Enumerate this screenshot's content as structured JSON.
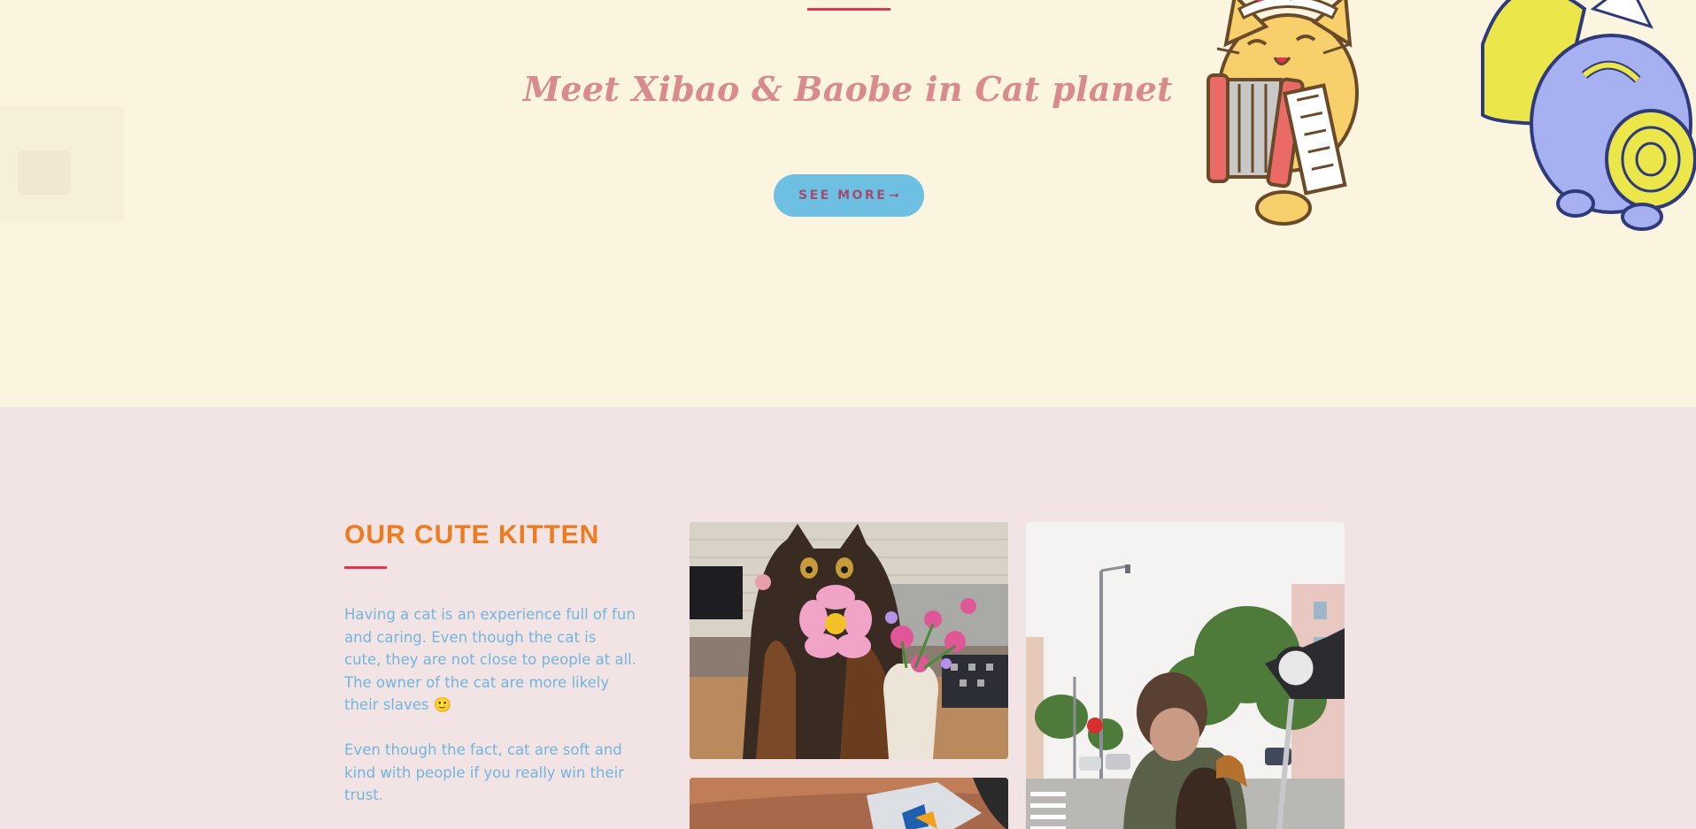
{
  "hero": {
    "title": "Meet Xibao & Baobe in Cat planet",
    "button_label": "SEE MORE",
    "button_arrow": "➞"
  },
  "kitten_section": {
    "heading": "OUR CUTE KITTEN",
    "paragraph1": "Having a cat is an experience full of fun and caring. Even though the cat is cute, they are not close to people at all. The owner of the cat are more likely their slaves 🙂",
    "paragraph2": "Even though the fact, cat are soft and kind with people if you really win their trust."
  },
  "colors": {
    "hero_bg": "#fbf4df",
    "section_bg": "#f2e4e4",
    "accent_red": "#e2364f",
    "heading_orange": "#ee7b20",
    "text_blue": "#73b5dc",
    "button_blue": "#6ec0e2",
    "title_pink": "#d98b8b"
  },
  "icons": {
    "button_arrow": "long-arrow-right-icon"
  }
}
